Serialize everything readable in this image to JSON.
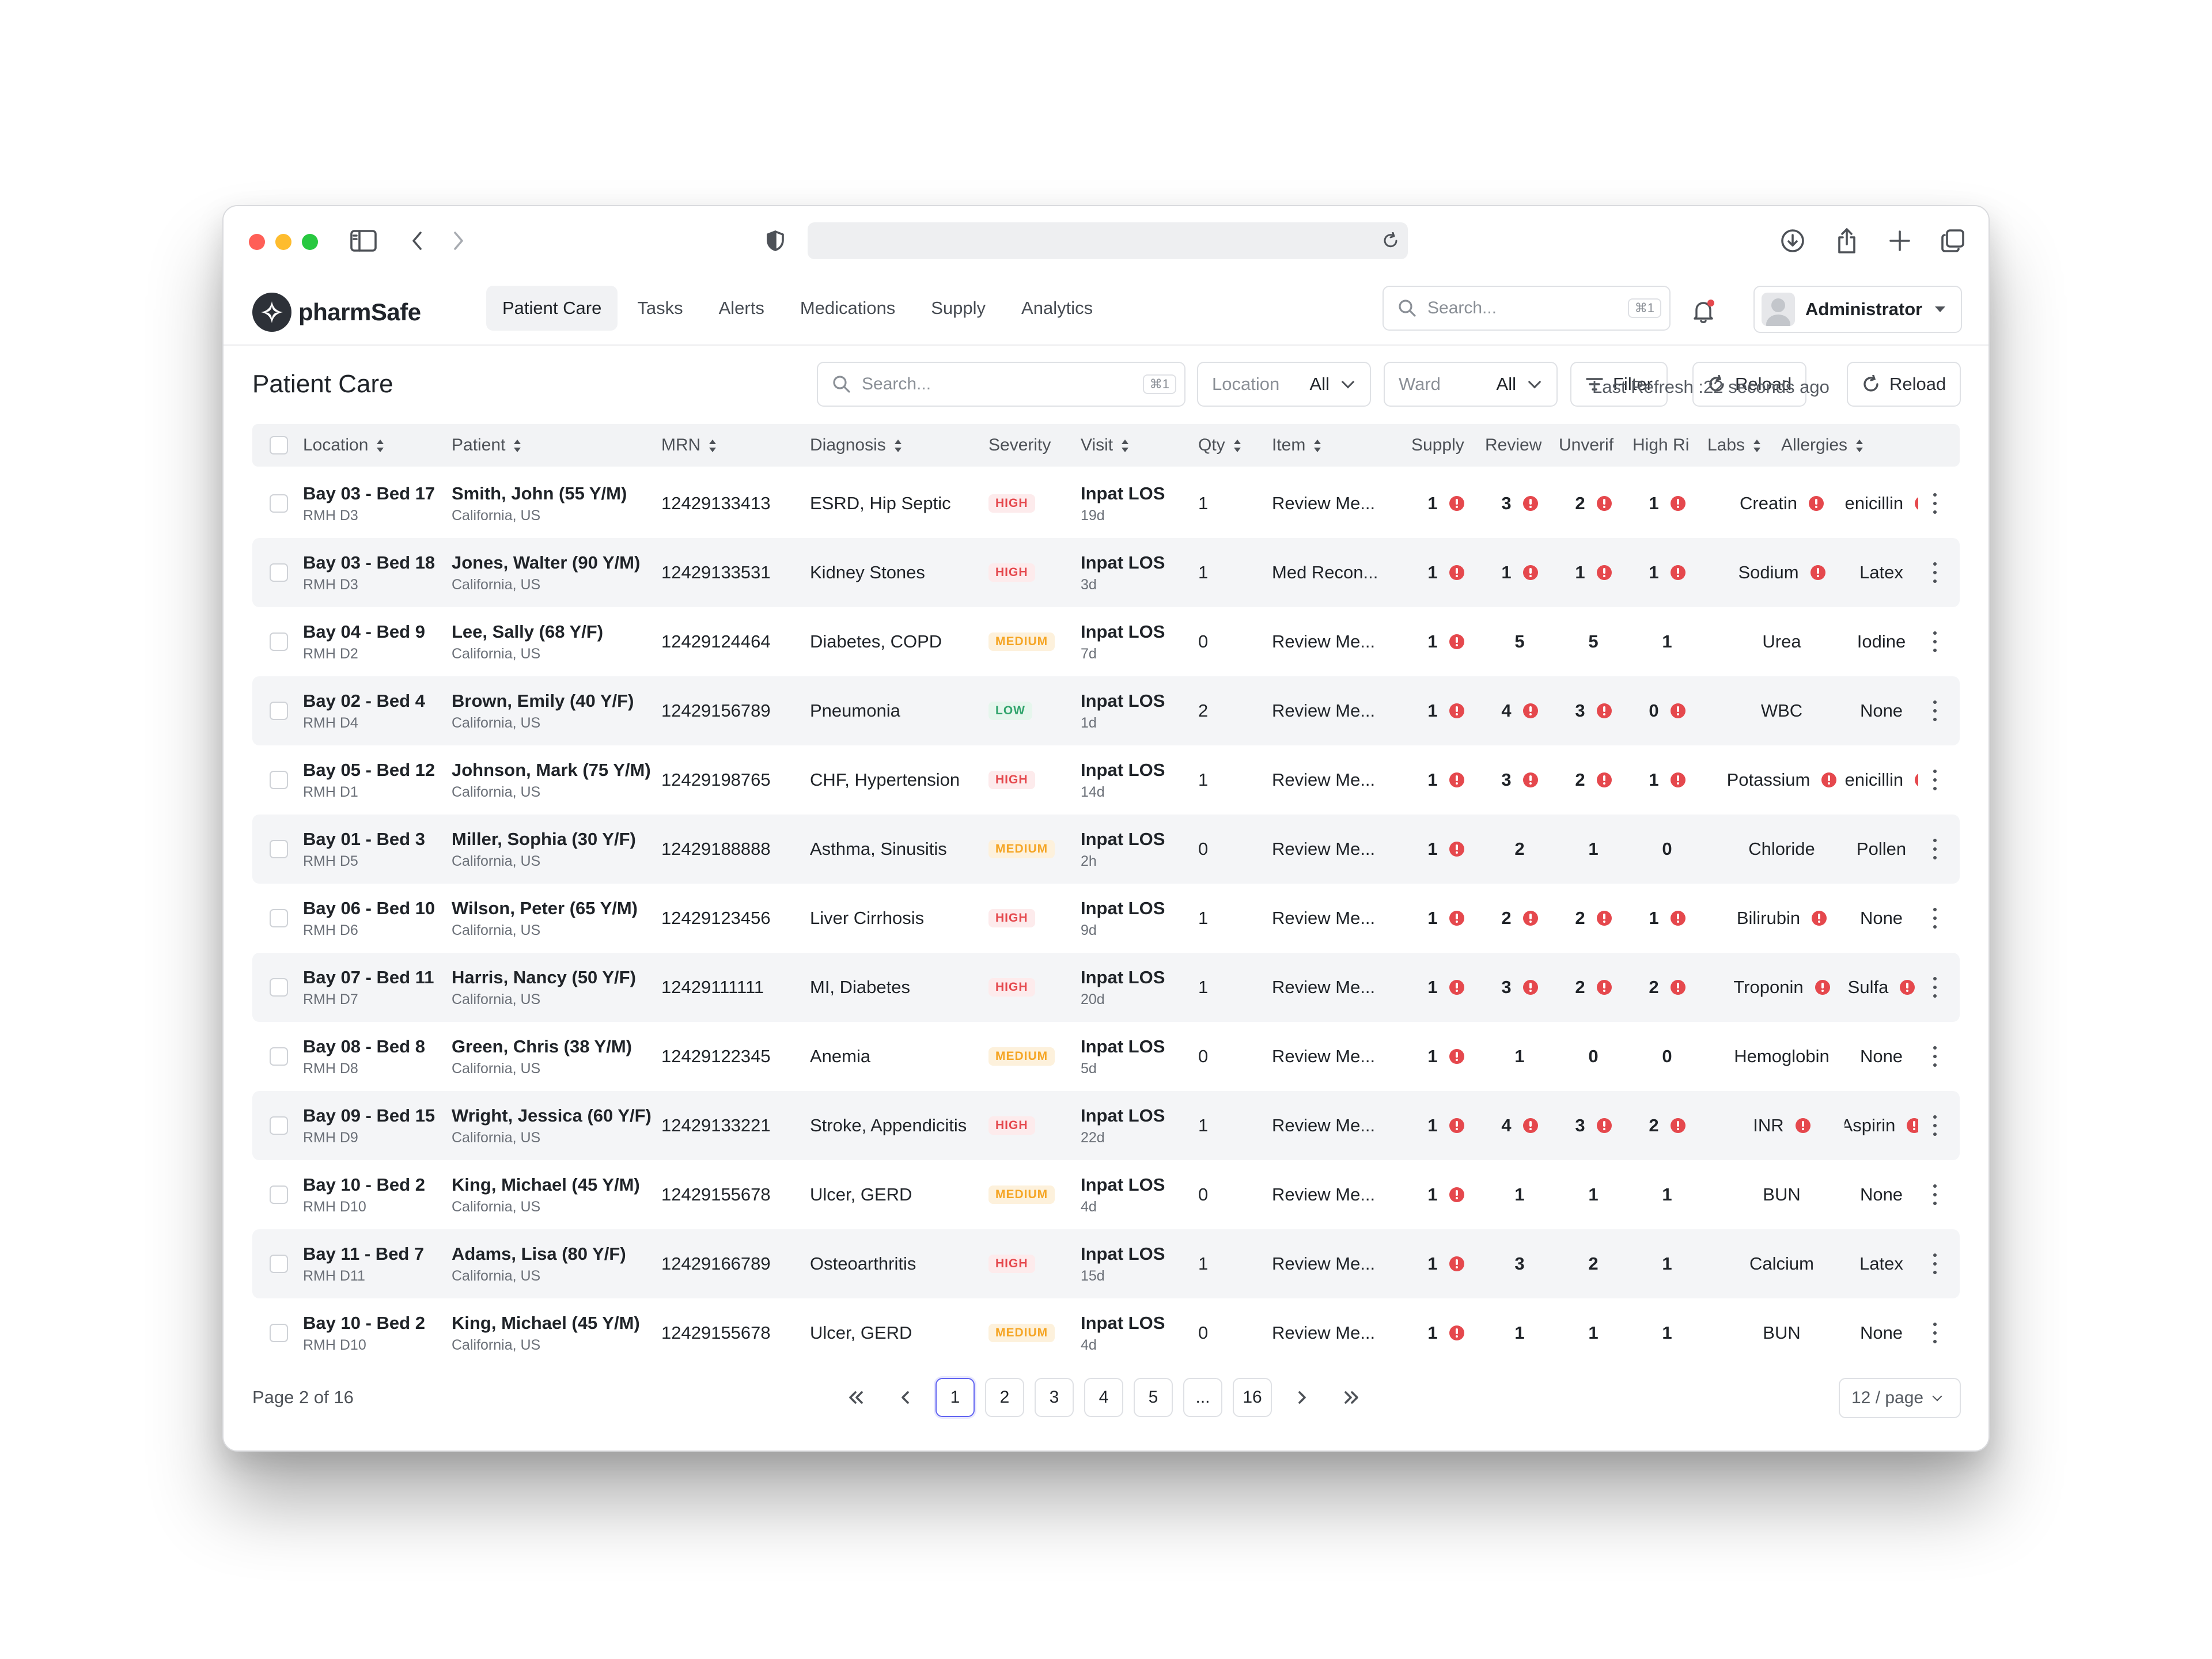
{
  "app": {
    "brand": "pharmSafe",
    "user": "Administrator"
  },
  "nav": {
    "tabs": [
      "Patient Care",
      "Tasks",
      "Alerts",
      "Medications",
      "Supply",
      "Analytics"
    ],
    "active_tab": "Patient Care",
    "search_placeholder": "Search...",
    "search_shortcut": "⌘1"
  },
  "page": {
    "title": "Patient Care",
    "search_placeholder": "Search...",
    "search_shortcut": "⌘1",
    "location_label": "Location",
    "location_value": "All",
    "ward_label": "Ward",
    "ward_value": "All",
    "filter_label": "Filter",
    "reload_label": "Reload",
    "last_refresh": "Last Refresh :22 seconds ago",
    "reload2_label": "Reload"
  },
  "table": {
    "columns": [
      "Location",
      "Patient",
      "MRN",
      "Diagnosis",
      "Severity",
      "Visit",
      "Qty",
      "Item",
      "Supply",
      "Review",
      "Unverif",
      "High Ri:",
      "Labs",
      "Allergies"
    ],
    "rows": [
      {
        "location": "Bay 03 - Bed 17",
        "unit": "RMH D3",
        "patient": "Smith, John (55 Y/M)",
        "region": "California, US",
        "mrn": "12429133413",
        "diagnosis": "ESRD, Hip Septic",
        "severity": "HIGH",
        "visit": "Inpat LOS",
        "los": "19d",
        "qty": "1",
        "item": "Review Me...",
        "supply": "1",
        "supply_alert": true,
        "review": "3",
        "review_alert": true,
        "unverif": "2",
        "unverif_alert": true,
        "highrisk": "1",
        "highrisk_alert": true,
        "labs": "Creatin",
        "labs_alert": true,
        "allergies": "Penicillin",
        "allergies_alert": true
      },
      {
        "location": "Bay 03 - Bed 18",
        "unit": "RMH D3",
        "patient": "Jones, Walter (90 Y/M)",
        "region": "California, US",
        "mrn": "12429133531",
        "diagnosis": "Kidney Stones",
        "severity": "HIGH",
        "visit": "Inpat LOS",
        "los": "3d",
        "qty": "1",
        "item": "Med Recon...",
        "supply": "1",
        "supply_alert": true,
        "review": "1",
        "review_alert": true,
        "unverif": "1",
        "unverif_alert": true,
        "highrisk": "1",
        "highrisk_alert": true,
        "labs": "Sodium",
        "labs_alert": true,
        "allergies": "Latex",
        "allergies_alert": false
      },
      {
        "location": "Bay 04 - Bed 9",
        "unit": "RMH D2",
        "patient": "Lee, Sally (68 Y/F)",
        "region": "California, US",
        "mrn": "12429124464",
        "diagnosis": "Diabetes, COPD",
        "severity": "MEDIUM",
        "visit": "Inpat LOS",
        "los": "7d",
        "qty": "0",
        "item": "Review Me...",
        "supply": "1",
        "supply_alert": true,
        "review": "5",
        "review_alert": false,
        "unverif": "5",
        "unverif_alert": false,
        "highrisk": "1",
        "highrisk_alert": false,
        "labs": "Urea",
        "labs_alert": false,
        "allergies": "Iodine",
        "allergies_alert": false
      },
      {
        "location": "Bay 02 - Bed 4",
        "unit": "RMH D4",
        "patient": "Brown, Emily (40 Y/F)",
        "region": "California, US",
        "mrn": "12429156789",
        "diagnosis": "Pneumonia",
        "severity": "LOW",
        "visit": "Inpat LOS",
        "los": "1d",
        "qty": "2",
        "item": "Review Me...",
        "supply": "1",
        "supply_alert": true,
        "review": "4",
        "review_alert": true,
        "unverif": "3",
        "unverif_alert": true,
        "highrisk": "0",
        "highrisk_alert": true,
        "labs": "WBC",
        "labs_alert": false,
        "allergies": "None",
        "allergies_alert": false
      },
      {
        "location": "Bay 05 - Bed 12",
        "unit": "RMH D1",
        "patient": "Johnson, Mark (75 Y/M)",
        "region": "California, US",
        "mrn": "12429198765",
        "diagnosis": "CHF, Hypertension",
        "severity": "HIGH",
        "visit": "Inpat LOS",
        "los": "14d",
        "qty": "1",
        "item": "Review Me...",
        "supply": "1",
        "supply_alert": true,
        "review": "3",
        "review_alert": true,
        "unverif": "2",
        "unverif_alert": true,
        "highrisk": "1",
        "highrisk_alert": true,
        "labs": "Potassium",
        "labs_alert": true,
        "allergies": "Penicillin",
        "allergies_alert": true
      },
      {
        "location": "Bay 01 - Bed 3",
        "unit": "RMH D5",
        "patient": "Miller, Sophia (30 Y/F)",
        "region": "California, US",
        "mrn": "12429188888",
        "diagnosis": "Asthma, Sinusitis",
        "severity": "MEDIUM",
        "visit": "Inpat LOS",
        "los": "2h",
        "qty": "0",
        "item": "Review Me...",
        "supply": "1",
        "supply_alert": true,
        "review": "2",
        "review_alert": false,
        "unverif": "1",
        "unverif_alert": false,
        "highrisk": "0",
        "highrisk_alert": false,
        "labs": "Chloride",
        "labs_alert": false,
        "allergies": "Pollen",
        "allergies_alert": false
      },
      {
        "location": "Bay 06 - Bed 10",
        "unit": "RMH D6",
        "patient": "Wilson, Peter (65 Y/M)",
        "region": "California, US",
        "mrn": "12429123456",
        "diagnosis": "Liver Cirrhosis",
        "severity": "HIGH",
        "visit": "Inpat LOS",
        "los": "9d",
        "qty": "1",
        "item": "Review Me...",
        "supply": "1",
        "supply_alert": true,
        "review": "2",
        "review_alert": true,
        "unverif": "2",
        "unverif_alert": true,
        "highrisk": "1",
        "highrisk_alert": true,
        "labs": "Bilirubin",
        "labs_alert": true,
        "allergies": "None",
        "allergies_alert": false
      },
      {
        "location": "Bay 07 - Bed 11",
        "unit": "RMH D7",
        "patient": "Harris, Nancy (50 Y/F)",
        "region": "California, US",
        "mrn": "12429111111",
        "diagnosis": "MI, Diabetes",
        "severity": "HIGH",
        "visit": "Inpat LOS",
        "los": "20d",
        "qty": "1",
        "item": "Review Me...",
        "supply": "1",
        "supply_alert": true,
        "review": "3",
        "review_alert": true,
        "unverif": "2",
        "unverif_alert": true,
        "highrisk": "2",
        "highrisk_alert": true,
        "labs": "Troponin",
        "labs_alert": true,
        "allergies": "Sulfa",
        "allergies_alert": true
      },
      {
        "location": "Bay 08 - Bed 8",
        "unit": "RMH D8",
        "patient": "Green, Chris (38 Y/M)",
        "region": "California, US",
        "mrn": "12429122345",
        "diagnosis": "Anemia",
        "severity": "MEDIUM",
        "visit": "Inpat LOS",
        "los": "5d",
        "qty": "0",
        "item": "Review Me...",
        "supply": "1",
        "supply_alert": true,
        "review": "1",
        "review_alert": false,
        "unverif": "0",
        "unverif_alert": false,
        "highrisk": "0",
        "highrisk_alert": false,
        "labs": "Hemoglobin",
        "labs_alert": false,
        "allergies": "None",
        "allergies_alert": false
      },
      {
        "location": "Bay 09 - Bed 15",
        "unit": "RMH D9",
        "patient": "Wright, Jessica (60 Y/F)",
        "region": "California, US",
        "mrn": "12429133221",
        "diagnosis": "Stroke, Appendicitis",
        "severity": "HIGH",
        "visit": "Inpat LOS",
        "los": "22d",
        "qty": "1",
        "item": "Review Me...",
        "supply": "1",
        "supply_alert": true,
        "review": "4",
        "review_alert": true,
        "unverif": "3",
        "unverif_alert": true,
        "highrisk": "2",
        "highrisk_alert": true,
        "labs": "INR",
        "labs_alert": true,
        "allergies": "Aspirin",
        "allergies_alert": true
      },
      {
        "location": "Bay 10 - Bed 2",
        "unit": "RMH D10",
        "patient": "King, Michael (45 Y/M)",
        "region": "California, US",
        "mrn": "12429155678",
        "diagnosis": "Ulcer, GERD",
        "severity": "MEDIUM",
        "visit": "Inpat LOS",
        "los": "4d",
        "qty": "0",
        "item": "Review Me...",
        "supply": "1",
        "supply_alert": true,
        "review": "1",
        "review_alert": false,
        "unverif": "1",
        "unverif_alert": false,
        "highrisk": "1",
        "highrisk_alert": false,
        "labs": "BUN",
        "labs_alert": false,
        "allergies": "None",
        "allergies_alert": false
      },
      {
        "location": "Bay 11 - Bed 7",
        "unit": "RMH D11",
        "patient": "Adams, Lisa (80 Y/F)",
        "region": "California, US",
        "mrn": "12429166789",
        "diagnosis": "Osteoarthritis",
        "severity": "HIGH",
        "visit": "Inpat LOS",
        "los": "15d",
        "qty": "1",
        "item": "Review Me...",
        "supply": "1",
        "supply_alert": true,
        "review": "3",
        "review_alert": false,
        "unverif": "2",
        "unverif_alert": false,
        "highrisk": "1",
        "highrisk_alert": false,
        "labs": "Calcium",
        "labs_alert": false,
        "allergies": "Latex",
        "allergies_alert": false
      },
      {
        "location": "Bay 10 - Bed 2",
        "unit": "RMH D10",
        "patient": "King, Michael (45 Y/M)",
        "region": "California, US",
        "mrn": "12429155678",
        "diagnosis": "Ulcer, GERD",
        "severity": "MEDIUM",
        "visit": "Inpat LOS",
        "los": "4d",
        "qty": "0",
        "item": "Review Me...",
        "supply": "1",
        "supply_alert": true,
        "review": "1",
        "review_alert": false,
        "unverif": "1",
        "unverif_alert": false,
        "highrisk": "1",
        "highrisk_alert": false,
        "labs": "BUN",
        "labs_alert": false,
        "allergies": "None",
        "allergies_alert": false
      }
    ]
  },
  "footer": {
    "page_info": "Page 2 of 16",
    "pages": [
      "1",
      "2",
      "3",
      "4",
      "5",
      "...",
      "16"
    ],
    "active_page": "1",
    "per_page": "12 / page"
  },
  "colors": {
    "accent": "#6366f1",
    "danger": "#e5484d",
    "warning": "#f5a524",
    "success": "#30a46c"
  }
}
